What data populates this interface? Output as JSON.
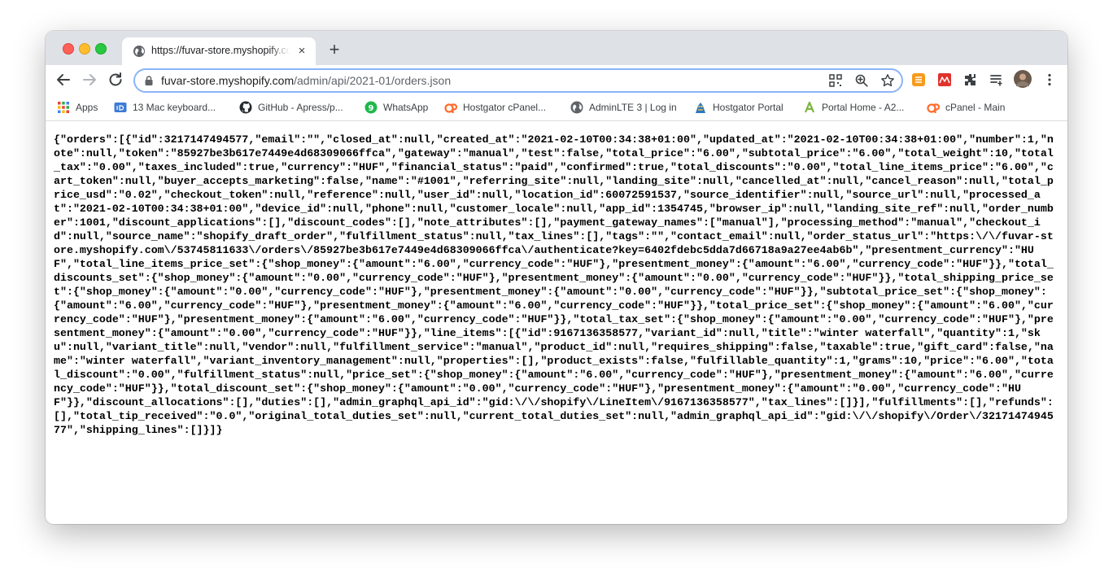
{
  "tab": {
    "title": "https://fuvar-store.myshopify.com/admin/api/2021-01/orders.json",
    "close": "×"
  },
  "new_tab": "+",
  "address": {
    "host": "fuvar-store.myshopify.com",
    "path": "/admin/api/2021-01/orders.json"
  },
  "bookmarks": [
    {
      "label": "Apps",
      "icon": "apps-grid-icon"
    },
    {
      "label": "13 Mac keyboard...",
      "icon": "idb-icon"
    },
    {
      "label": "GitHub - Apress/p...",
      "icon": "github-icon"
    },
    {
      "label": "WhatsApp",
      "icon": "whatsapp-icon"
    },
    {
      "label": "Hostgator cPanel...",
      "icon": "cpanel-icon"
    },
    {
      "label": "AdminLTE 3 | Log in",
      "icon": "globe-icon"
    },
    {
      "label": "Hostgator Portal",
      "icon": "hostgator-icon"
    },
    {
      "label": "Portal Home - A2...",
      "icon": "a2-icon"
    },
    {
      "label": "cPanel - Main",
      "icon": "cpanel-icon"
    }
  ],
  "colors": {
    "accent": "#8ab4f8",
    "tabstrip": "#dee1e6"
  },
  "body_text": "{\"orders\":[{\"id\":3217147494577,\"email\":\"\",\"closed_at\":null,\"created_at\":\"2021-02-10T00:34:38+01:00\",\"updated_at\":\"2021-02-10T00:34:38+01:00\",\"number\":1,\"note\":null,\"token\":\"85927be3b617e7449e4d68309066ffca\",\"gateway\":\"manual\",\"test\":false,\"total_price\":\"6.00\",\"subtotal_price\":\"6.00\",\"total_weight\":10,\"total_tax\":\"0.00\",\"taxes_included\":true,\"currency\":\"HUF\",\"financial_status\":\"paid\",\"confirmed\":true,\"total_discounts\":\"0.00\",\"total_line_items_price\":\"6.00\",\"cart_token\":null,\"buyer_accepts_marketing\":false,\"name\":\"#1001\",\"referring_site\":null,\"landing_site\":null,\"cancelled_at\":null,\"cancel_reason\":null,\"total_price_usd\":\"0.02\",\"checkout_token\":null,\"reference\":null,\"user_id\":null,\"location_id\":60072591537,\"source_identifier\":null,\"source_url\":null,\"processed_at\":\"2021-02-10T00:34:38+01:00\",\"device_id\":null,\"phone\":null,\"customer_locale\":null,\"app_id\":1354745,\"browser_ip\":null,\"landing_site_ref\":null,\"order_number\":1001,\"discount_applications\":[],\"discount_codes\":[],\"note_attributes\":[],\"payment_gateway_names\":[\"manual\"],\"processing_method\":\"manual\",\"checkout_id\":null,\"source_name\":\"shopify_draft_order\",\"fulfillment_status\":null,\"tax_lines\":[],\"tags\":\"\",\"contact_email\":null,\"order_status_url\":\"https:\\/\\/fuvar-store.myshopify.com\\/53745811633\\/orders\\/85927be3b617e7449e4d68309066ffca\\/authenticate?key=6402fdebc5dda7d66718a9a27ee4ab6b\",\"presentment_currency\":\"HUF\",\"total_line_items_price_set\":{\"shop_money\":{\"amount\":\"6.00\",\"currency_code\":\"HUF\"},\"presentment_money\":{\"amount\":\"6.00\",\"currency_code\":\"HUF\"}},\"total_discounts_set\":{\"shop_money\":{\"amount\":\"0.00\",\"currency_code\":\"HUF\"},\"presentment_money\":{\"amount\":\"0.00\",\"currency_code\":\"HUF\"}},\"total_shipping_price_set\":{\"shop_money\":{\"amount\":\"0.00\",\"currency_code\":\"HUF\"},\"presentment_money\":{\"amount\":\"0.00\",\"currency_code\":\"HUF\"}},\"subtotal_price_set\":{\"shop_money\":{\"amount\":\"6.00\",\"currency_code\":\"HUF\"},\"presentment_money\":{\"amount\":\"6.00\",\"currency_code\":\"HUF\"}},\"total_price_set\":{\"shop_money\":{\"amount\":\"6.00\",\"currency_code\":\"HUF\"},\"presentment_money\":{\"amount\":\"6.00\",\"currency_code\":\"HUF\"}},\"total_tax_set\":{\"shop_money\":{\"amount\":\"0.00\",\"currency_code\":\"HUF\"},\"presentment_money\":{\"amount\":\"0.00\",\"currency_code\":\"HUF\"}},\"line_items\":[{\"id\":9167136358577,\"variant_id\":null,\"title\":\"winter waterfall\",\"quantity\":1,\"sku\":null,\"variant_title\":null,\"vendor\":null,\"fulfillment_service\":\"manual\",\"product_id\":null,\"requires_shipping\":false,\"taxable\":true,\"gift_card\":false,\"name\":\"winter waterfall\",\"variant_inventory_management\":null,\"properties\":[],\"product_exists\":false,\"fulfillable_quantity\":1,\"grams\":10,\"price\":\"6.00\",\"total_discount\":\"0.00\",\"fulfillment_status\":null,\"price_set\":{\"shop_money\":{\"amount\":\"6.00\",\"currency_code\":\"HUF\"},\"presentment_money\":{\"amount\":\"6.00\",\"currency_code\":\"HUF\"}},\"total_discount_set\":{\"shop_money\":{\"amount\":\"0.00\",\"currency_code\":\"HUF\"},\"presentment_money\":{\"amount\":\"0.00\",\"currency_code\":\"HUF\"}},\"discount_allocations\":[],\"duties\":[],\"admin_graphql_api_id\":\"gid:\\/\\/shopify\\/LineItem\\/9167136358577\",\"tax_lines\":[]}],\"fulfillments\":[],\"refunds\":[],\"total_tip_received\":\"0.0\",\"original_total_duties_set\":null,\"current_total_duties_set\":null,\"admin_graphql_api_id\":\"gid:\\/\\/shopify\\/Order\\/3217147494577\",\"shipping_lines\":[]}]}"
}
